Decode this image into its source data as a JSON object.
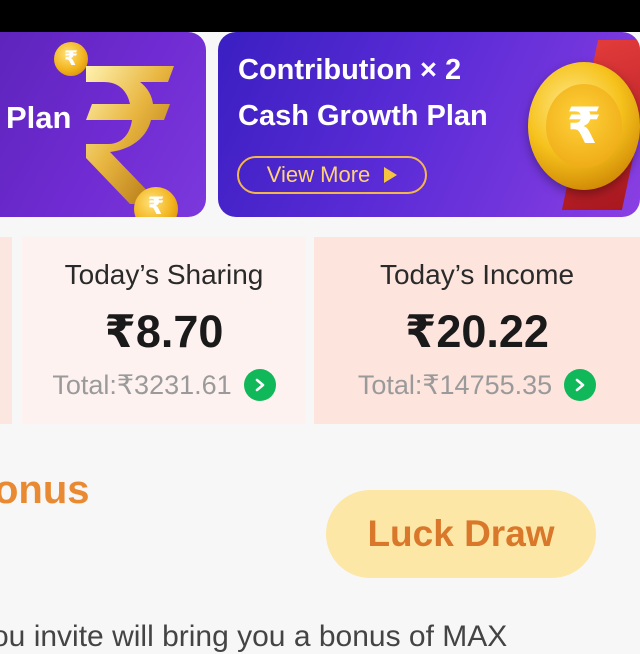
{
  "banners": {
    "left": {
      "title_fragment": "Plan"
    },
    "right": {
      "title_line1": "Contribution × 2",
      "title_line2": "Cash Growth Plan",
      "button_label": "View More"
    }
  },
  "stats": {
    "sharing": {
      "label": "Today’s Sharing",
      "value": "₹8.70",
      "total": "Total:₹3231.61"
    },
    "income": {
      "label": "Today’s Income",
      "value": "₹20.22",
      "total": "Total:₹14755.35"
    }
  },
  "bonus": {
    "title_fragment": "onus",
    "button_label": "Luck Draw",
    "description": "ou invite will bring you a bonus of MAX"
  },
  "icons": {
    "rupee_coin": "rupee-coin-icon",
    "medal": "gold-medal-icon",
    "chevron": "chevron-right-icon",
    "play": "play-arrow-icon"
  },
  "colors": {
    "banner_purple": "#6f2bd1",
    "accent_green": "#10b85a",
    "bonus_orange": "#e98a33",
    "luck_draw_bg": "#fde7a6",
    "card_pink": "#fde4dd"
  }
}
